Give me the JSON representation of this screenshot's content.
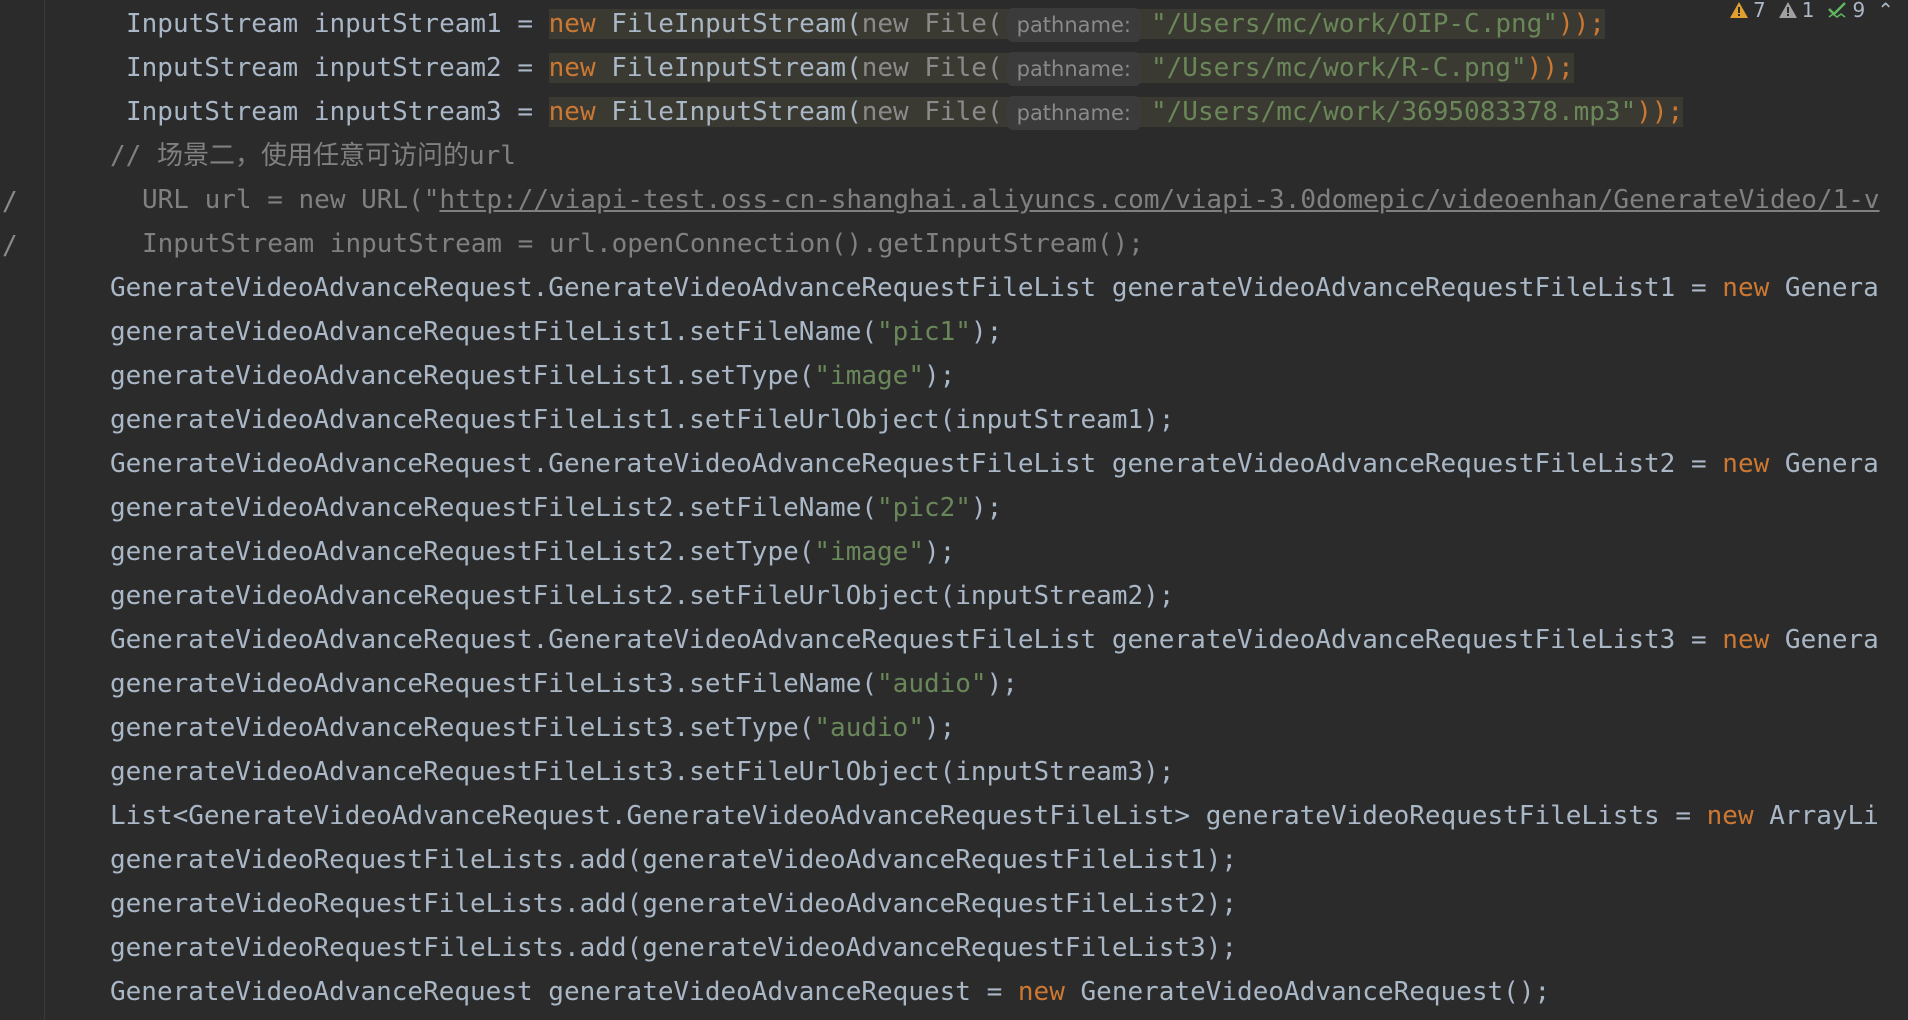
{
  "inspections": {
    "warnings": "7",
    "weak_warnings": "1",
    "typos": "9",
    "warning_color": "#e0a030",
    "weak_color": "#a0a0a0",
    "ok_color": "#5fb760"
  },
  "lines": {
    "l1": {
      "pre": "InputStream inputStream1 = ",
      "kw": "new",
      "cls": " FileInputStream(",
      "dim": "new File(",
      "hint": "pathname:",
      "str": "\"/Users/mc/work/OIP-C.png\"",
      "end": "));"
    },
    "l2": {
      "pre": "InputStream inputStream2 = ",
      "kw": "new",
      "cls": " FileInputStream(",
      "dim": "new File(",
      "hint": "pathname:",
      "str": "\"/Users/mc/work/R-C.png\"",
      "end": "));"
    },
    "l3": {
      "pre": "InputStream inputStream3 = ",
      "kw": "new",
      "cls": " FileInputStream(",
      "dim": "new File(",
      "hint": "pathname:",
      "str": "\"/Users/mc/work/3695083378.mp3\"",
      "end": "));"
    },
    "l4": {
      "text": "// 场景二，使用任意可访问的url"
    },
    "l5": {
      "pre": "URL url = new URL(\"",
      "link": "http://viapi-test.oss-cn-shanghai.aliyuncs.com/viapi-3.0domepic/videoenhan/GenerateVideo/1-v"
    },
    "l6": {
      "text": "InputStream inputStream = url.openConnection().getInputStream();"
    },
    "l7": {
      "pre": "GenerateVideoAdvanceRequest.GenerateVideoAdvanceRequestFileList generateVideoAdvanceRequestFileList1 = ",
      "kw": "new",
      "post": " Genera"
    },
    "l8": {
      "pre": "generateVideoAdvanceRequestFileList1.setFileName(",
      "str": "\"pic1\"",
      "end": ");"
    },
    "l9": {
      "pre": "generateVideoAdvanceRequestFileList1.setType(",
      "str": "\"image\"",
      "end": ");"
    },
    "l10": {
      "pre": "generateVideoAdvanceRequestFileList1.setFileUrlObject(inputStream1);"
    },
    "l11": {
      "pre": "GenerateVideoAdvanceRequest.GenerateVideoAdvanceRequestFileList generateVideoAdvanceRequestFileList2 = ",
      "kw": "new",
      "post": " Genera"
    },
    "l12": {
      "pre": "generateVideoAdvanceRequestFileList2.setFileName(",
      "str": "\"pic2\"",
      "end": ");"
    },
    "l13": {
      "pre": "generateVideoAdvanceRequestFileList2.setType(",
      "str": "\"image\"",
      "end": ");"
    },
    "l14": {
      "pre": "generateVideoAdvanceRequestFileList2.setFileUrlObject(inputStream2);"
    },
    "l15": {
      "pre": "GenerateVideoAdvanceRequest.GenerateVideoAdvanceRequestFileList generateVideoAdvanceRequestFileList3 = ",
      "kw": "new",
      "post": " Genera"
    },
    "l16": {
      "pre": "generateVideoAdvanceRequestFileList3.setFileName(",
      "str": "\"audio\"",
      "end": ");"
    },
    "l17": {
      "pre": "generateVideoAdvanceRequestFileList3.setType(",
      "str": "\"audio\"",
      "end": ");"
    },
    "l18": {
      "pre": "generateVideoAdvanceRequestFileList3.setFileUrlObject(inputStream3);"
    },
    "l19": {
      "pre": "List<GenerateVideoAdvanceRequest.GenerateVideoAdvanceRequestFileList> generateVideoRequestFileLists = ",
      "kw": "new",
      "post": " ArrayLi"
    },
    "l20": {
      "pre": "generateVideoRequestFileLists.add(generateVideoAdvanceRequestFileList1);"
    },
    "l21": {
      "pre": "generateVideoRequestFileLists.add(generateVideoAdvanceRequestFileList2);"
    },
    "l22": {
      "pre": "generateVideoRequestFileLists.add(generateVideoAdvanceRequestFileList3);"
    },
    "l23": {
      "pre": "GenerateVideoAdvanceRequest generateVideoAdvanceRequest = ",
      "kw": "new",
      "post": " GenerateVideoAdvanceRequest();"
    }
  }
}
